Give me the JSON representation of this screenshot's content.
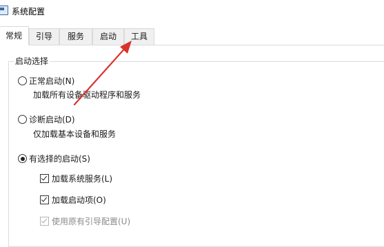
{
  "window": {
    "title": "系统配置",
    "icon": "msconfig-icon"
  },
  "tabs": [
    {
      "label": "常规",
      "active": true
    },
    {
      "label": "引导",
      "active": false
    },
    {
      "label": "服务",
      "active": false
    },
    {
      "label": "启动",
      "active": false
    },
    {
      "label": "工具",
      "active": false
    }
  ],
  "startup_selection": {
    "group_title": "启动选择",
    "options": [
      {
        "label": "正常启动(N)",
        "description": "加载所有设备驱动程序和服务",
        "selected": false
      },
      {
        "label": "诊断启动(D)",
        "description": "仅加载基本设备和服务",
        "selected": false
      },
      {
        "label": "有选择的启动(S)",
        "selected": true
      }
    ],
    "selective_items": [
      {
        "label": "加载系统服务(L)",
        "checked": true,
        "enabled": true
      },
      {
        "label": "加载启动项(O)",
        "checked": true,
        "enabled": true
      },
      {
        "label": "使用原有引导配置(U)",
        "checked": true,
        "enabled": false
      }
    ]
  },
  "annotation": {
    "arrow_color": "#d9322b",
    "points_to": "tab-tools"
  }
}
